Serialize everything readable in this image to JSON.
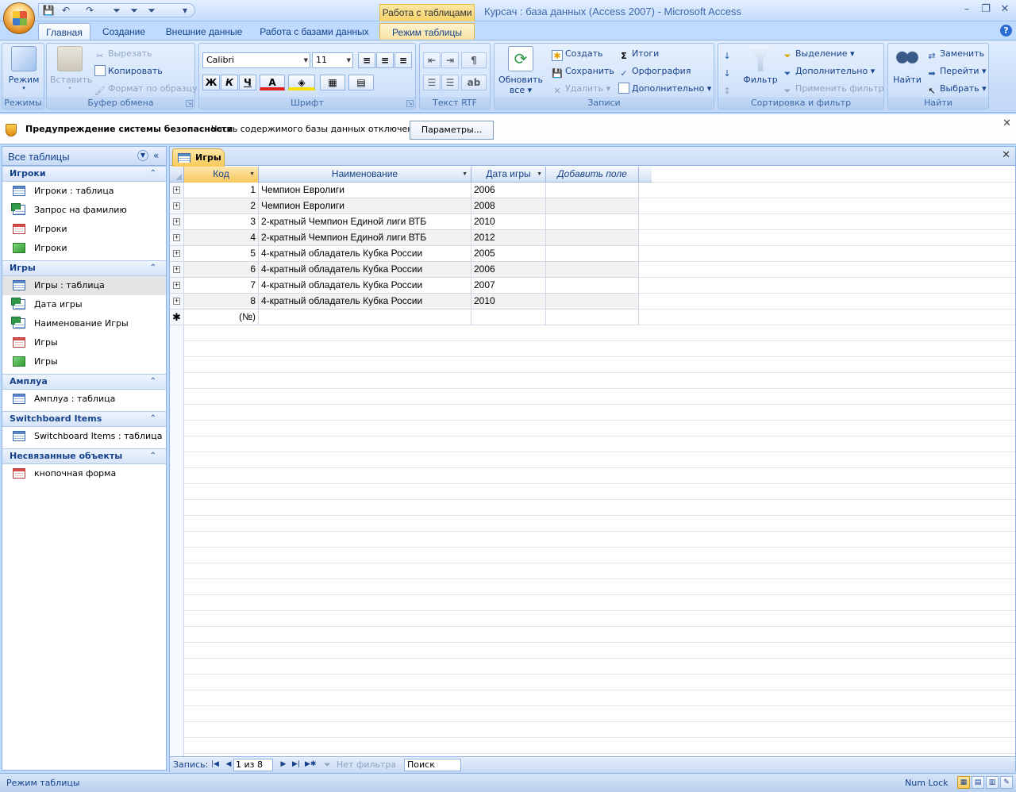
{
  "window": {
    "app_title": "Курсач : база данных (Access 2007)  -  Microsoft Access",
    "context_group": "Работа с таблицами",
    "buttons": {
      "minimize": "–",
      "restore": "❐",
      "close": "✕"
    }
  },
  "qat": {
    "save": "💾",
    "undo": "↶",
    "redo": "↷",
    "filter1": "⏷",
    "filter2": "⏷",
    "filter3": "⏷",
    "more": "▾"
  },
  "ribbon_tabs": [
    {
      "label": "Главная"
    },
    {
      "label": "Создание"
    },
    {
      "label": "Внешние данные"
    },
    {
      "label": "Работа с базами данных"
    },
    {
      "label": "Режим таблицы"
    }
  ],
  "help": "?",
  "ribbon": {
    "views": {
      "label": "Режимы",
      "mode_btn": "Режим"
    },
    "clipboard": {
      "label": "Буфер обмена",
      "paste": "Вставить",
      "cut": "Вырезать",
      "copy": "Копировать",
      "format_painter": "Формат по образцу"
    },
    "font": {
      "label": "Шрифт",
      "font_name": "Calibri",
      "font_size": "11",
      "bold": "Ж",
      "italic": "К",
      "underline": "Ч",
      "font_color": "A"
    },
    "rtf": {
      "label": "Текст RTF"
    },
    "records": {
      "label": "Записи",
      "refresh": "Обновить",
      "refresh2": "все",
      "new": "Создать",
      "save": "Сохранить",
      "delete": "Удалить",
      "totals": "Итоги",
      "spelling": "Орфография",
      "more": "Дополнительно"
    },
    "sort": {
      "label": "Сортировка и фильтр",
      "filter": "Фильтр",
      "selection": "Выделение",
      "advanced": "Дополнительно",
      "apply": "Применить фильтр"
    },
    "find": {
      "label": "Найти",
      "find": "Найти",
      "replace": "Заменить",
      "goto": "Перейти",
      "select": "Выбрать"
    }
  },
  "security": {
    "title": "Предупреждение системы безопасности",
    "message": "Часть содержимого базы данных отключено",
    "button": "Параметры...",
    "close": "✕"
  },
  "nav": {
    "title": "Все таблицы",
    "sections": [
      {
        "name": "Игроки",
        "items": [
          {
            "label": "Игроки : таблица",
            "type": "table"
          },
          {
            "label": "Запрос на фамилию",
            "type": "query"
          },
          {
            "label": "Игроки",
            "type": "form"
          },
          {
            "label": "Игроки",
            "type": "report"
          }
        ]
      },
      {
        "name": "Игры",
        "items": [
          {
            "label": "Игры : таблица",
            "type": "table"
          },
          {
            "label": "Дата игры",
            "type": "query"
          },
          {
            "label": "Наименование Игры",
            "type": "query"
          },
          {
            "label": "Игры",
            "type": "form"
          },
          {
            "label": "Игры",
            "type": "report"
          }
        ]
      },
      {
        "name": "Амплуа",
        "items": [
          {
            "label": "Амплуа : таблица",
            "type": "table"
          }
        ]
      },
      {
        "name": "Switchboard Items",
        "items": [
          {
            "label": "Switchboard Items : таблица",
            "type": "table"
          }
        ]
      },
      {
        "name": "Несвязанные объекты",
        "items": [
          {
            "label": "кнопочная форма",
            "type": "form"
          }
        ]
      }
    ]
  },
  "document": {
    "tab": "Игры",
    "close": "✕",
    "columns": [
      "Код",
      "Наименование",
      "Дата игры",
      "Добавить поле"
    ],
    "rows": [
      {
        "id": "1",
        "name": "Чемпион Евролиги",
        "date": "2006"
      },
      {
        "id": "2",
        "name": "Чемпион Евролиги",
        "date": "2008"
      },
      {
        "id": "3",
        "name": "2-кратный Чемпион Единой лиги ВТБ",
        "date": "2010"
      },
      {
        "id": "4",
        "name": "2-кратный Чемпион Единой лиги ВТБ",
        "date": "2012"
      },
      {
        "id": "5",
        "name": "4-кратный обладатель Кубка России",
        "date": "2005"
      },
      {
        "id": "6",
        "name": "4-кратный обладатель Кубка России",
        "date": "2006"
      },
      {
        "id": "7",
        "name": "4-кратный обладатель Кубка России",
        "date": "2007"
      },
      {
        "id": "8",
        "name": "4-кратный обладатель Кубка России",
        "date": "2010"
      }
    ],
    "new_row": {
      "marker": "✱",
      "id": "(№)"
    },
    "record_nav": {
      "label": "Запись:",
      "current": "1 из 8",
      "no_filter": "Нет фильтра",
      "search": "Поиск"
    }
  },
  "status": {
    "mode": "Режим таблицы",
    "numlock": "Num Lock"
  }
}
